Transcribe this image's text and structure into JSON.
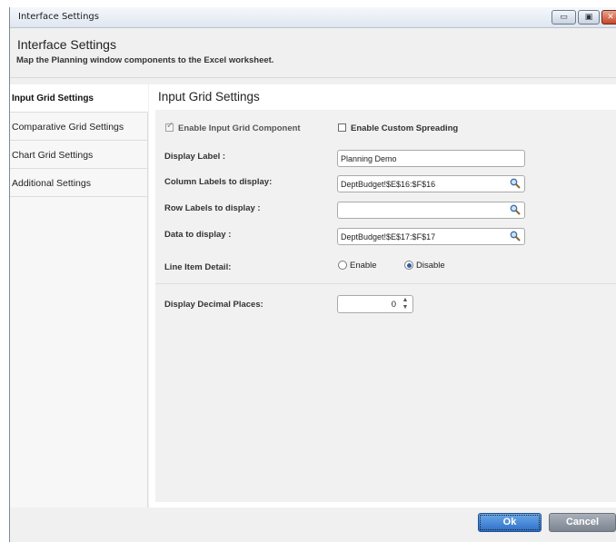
{
  "window": {
    "title": "Interface Settings",
    "min_glyph": "▭",
    "max_glyph": "▣",
    "close_glyph": "✕"
  },
  "header": {
    "title": "Interface Settings",
    "subtitle": "Map the Planning window components to the Excel worksheet."
  },
  "nav": {
    "items": [
      {
        "label": "Input Grid Settings",
        "active": true
      },
      {
        "label": "Comparative Grid Settings",
        "active": false
      },
      {
        "label": "Chart Grid Settings",
        "active": false
      },
      {
        "label": "Additional Settings",
        "active": false
      }
    ]
  },
  "content": {
    "title": "Input Grid Settings",
    "enable_input_grid": {
      "label": "Enable Input Grid Component",
      "checked": true,
      "disabled": true
    },
    "enable_custom_spreading": {
      "label": "Enable Custom Spreading",
      "checked": false
    },
    "display_label": {
      "label": "Display Label :",
      "value": "Planning Demo"
    },
    "column_labels": {
      "label": "Column Labels to display:",
      "value": "DeptBudget!$E$16:$F$16"
    },
    "row_labels": {
      "label": "Row Labels to display :",
      "value": ""
    },
    "data_to_display": {
      "label": "Data to display :",
      "value": "DeptBudget!$E$17:$F$17"
    },
    "line_item_detail": {
      "label": "Line Item Detail:",
      "options": [
        {
          "label": "Enable",
          "selected": false
        },
        {
          "label": "Disable",
          "selected": true
        }
      ]
    },
    "decimal_places": {
      "label": "Display Decimal Places:",
      "value": "0"
    }
  },
  "footer": {
    "ok_label": "Ok",
    "cancel_label": "Cancel"
  },
  "colors": {
    "accent": "#2f6fc8",
    "close_red": "#c8452a"
  }
}
